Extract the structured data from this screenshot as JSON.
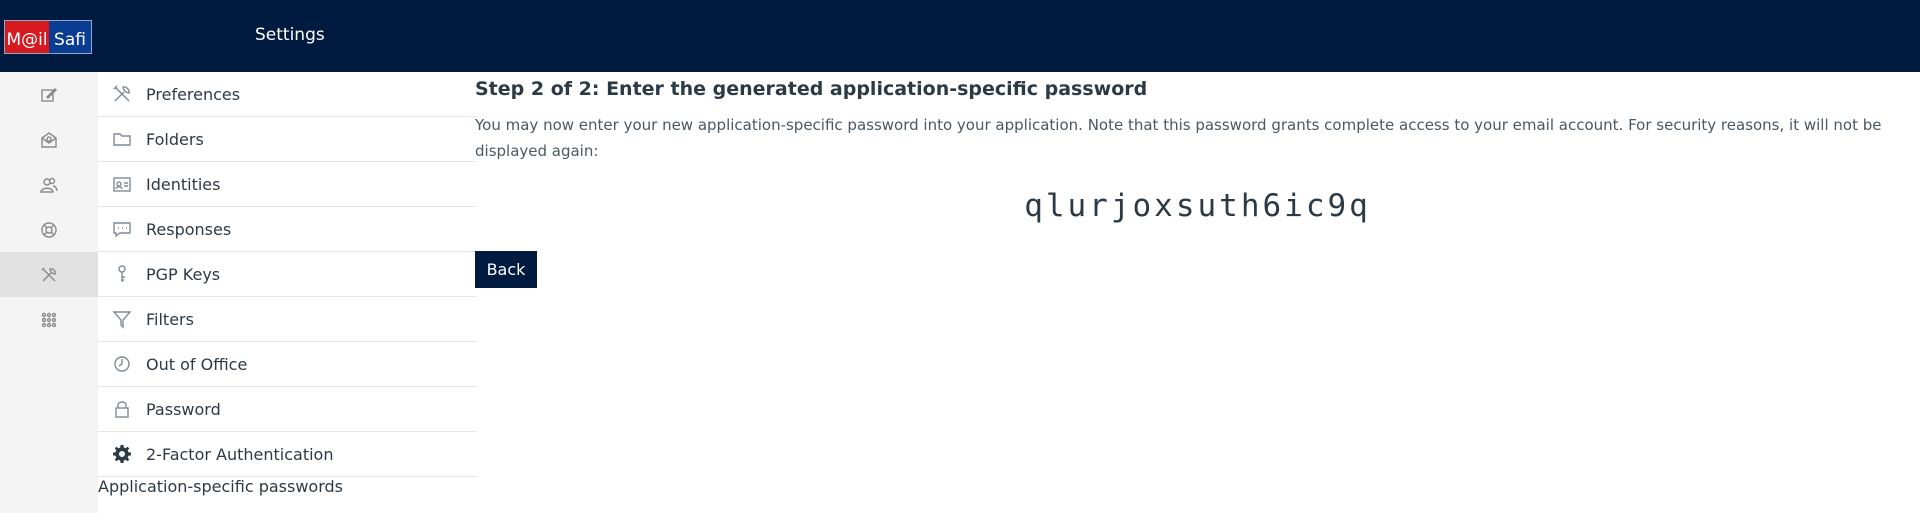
{
  "header": {
    "logo_left": "M@il",
    "logo_right": "Safi",
    "title": "Settings"
  },
  "rail": {
    "items": [
      {
        "icon": "compose-icon"
      },
      {
        "icon": "mail-icon"
      },
      {
        "icon": "contacts-icon"
      },
      {
        "icon": "help-icon"
      },
      {
        "icon": "settings-icon",
        "active": true
      },
      {
        "icon": "apps-grid-icon"
      }
    ]
  },
  "settings": {
    "items": [
      {
        "label": "Preferences",
        "icon": "tools-icon"
      },
      {
        "label": "Folders",
        "icon": "folder-icon"
      },
      {
        "label": "Identities",
        "icon": "id-card-icon"
      },
      {
        "label": "Responses",
        "icon": "chat-icon"
      },
      {
        "label": "PGP Keys",
        "icon": "key-icon"
      },
      {
        "label": "Filters",
        "icon": "filter-icon"
      },
      {
        "label": "Out of Office",
        "icon": "clock-icon"
      },
      {
        "label": "Password",
        "icon": "lock-icon"
      },
      {
        "label": "2-Factor Authentication",
        "icon": "gear-icon"
      }
    ],
    "sub_item": "Application-specific passwords"
  },
  "main": {
    "step_title": "Step 2 of 2: Enter the generated application-specific password",
    "description": "You may now enter your new application-specific password into your application. Note that this password grants complete access to your email account. For security reasons, it will not be displayed again:",
    "password": "qlurjoxsuth6ic9q",
    "back_label": "Back"
  },
  "colors": {
    "header_bg": "#001a40",
    "button_bg": "#001a40",
    "logo_red": "#d71920",
    "logo_blue": "#0a3d91"
  }
}
